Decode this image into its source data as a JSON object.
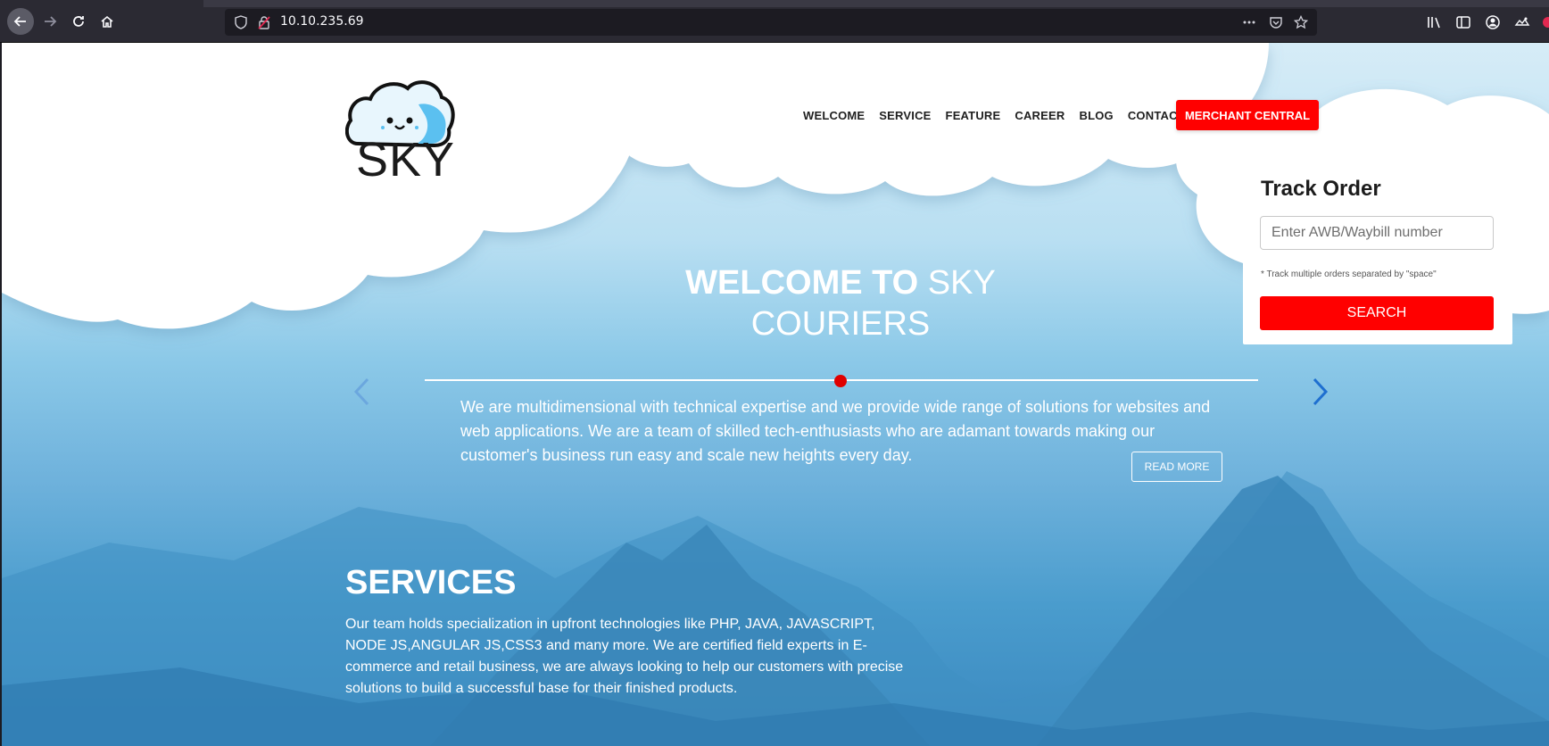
{
  "browser": {
    "url": "10.10.235.69"
  },
  "site": {
    "logo_text": "SKY",
    "nav": [
      "WELCOME",
      "SERVICE",
      "FEATURE",
      "CAREER",
      "BLOG",
      "CONTACT"
    ],
    "merchant_button": "MERCHANT CENTRAL"
  },
  "track": {
    "title": "Track Order",
    "placeholder": "Enter AWB/Waybill number",
    "note": "* Track multiple orders separated by \"space\"",
    "button": "SEARCH"
  },
  "hero": {
    "title_bold": "WELCOME TO",
    "title_light": "SKY COURIERS",
    "text": "We are multidimensional with technical expertise and we provide wide range of solutions for websites and web applications. We are a team of skilled tech-enthusiasts who are adamant towards making our customer's business run easy and scale new heights every day.",
    "read_more": "READ MORE"
  },
  "services": {
    "title": "SERVICES",
    "text": "Our team holds specialization in upfront technologies like PHP, JAVA, JAVASCRIPT, NODE JS,ANGULAR JS,CSS3 and many more. We are certified field experts in E-commerce and retail business, we are always looking to help our customers with precise solutions to build a successful base for their finished products."
  },
  "colors": {
    "accent": "#ff0000",
    "slider_arrow": "#1e88e5"
  }
}
